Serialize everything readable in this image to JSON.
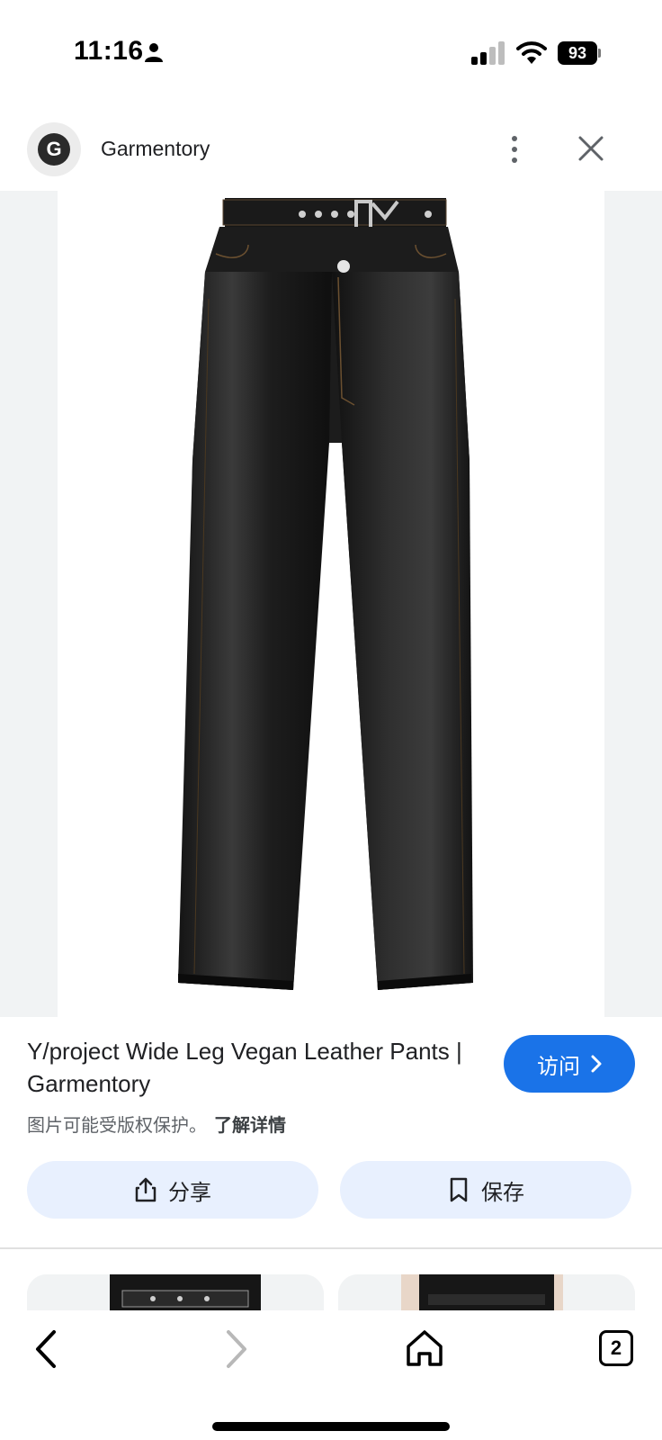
{
  "status_bar": {
    "time": "11:16",
    "battery_level": "93",
    "icons": [
      "person-icon",
      "signal-icon",
      "wifi-icon",
      "battery-icon"
    ]
  },
  "header": {
    "source_logo_letter": "G",
    "source_name": "Garmentory",
    "more_icon": "more-vertical-icon",
    "close_icon": "close-icon"
  },
  "result": {
    "title": "Y/project Wide Leg Vegan Leather Pants | Garmentory",
    "visit_label": "访问",
    "copyright_notice": "图片可能受版权保护。",
    "learn_more": "了解详情",
    "share_label": "分享",
    "save_label": "保存"
  },
  "bottom_nav": {
    "tab_count": "2",
    "icons": [
      "back-arrow-icon",
      "forward-arrow-icon",
      "home-icon",
      "tabs-icon"
    ]
  },
  "colors": {
    "accent": "#1a73e8",
    "chip_background": "#e8f0fe",
    "image_background": "#f1f3f4"
  }
}
